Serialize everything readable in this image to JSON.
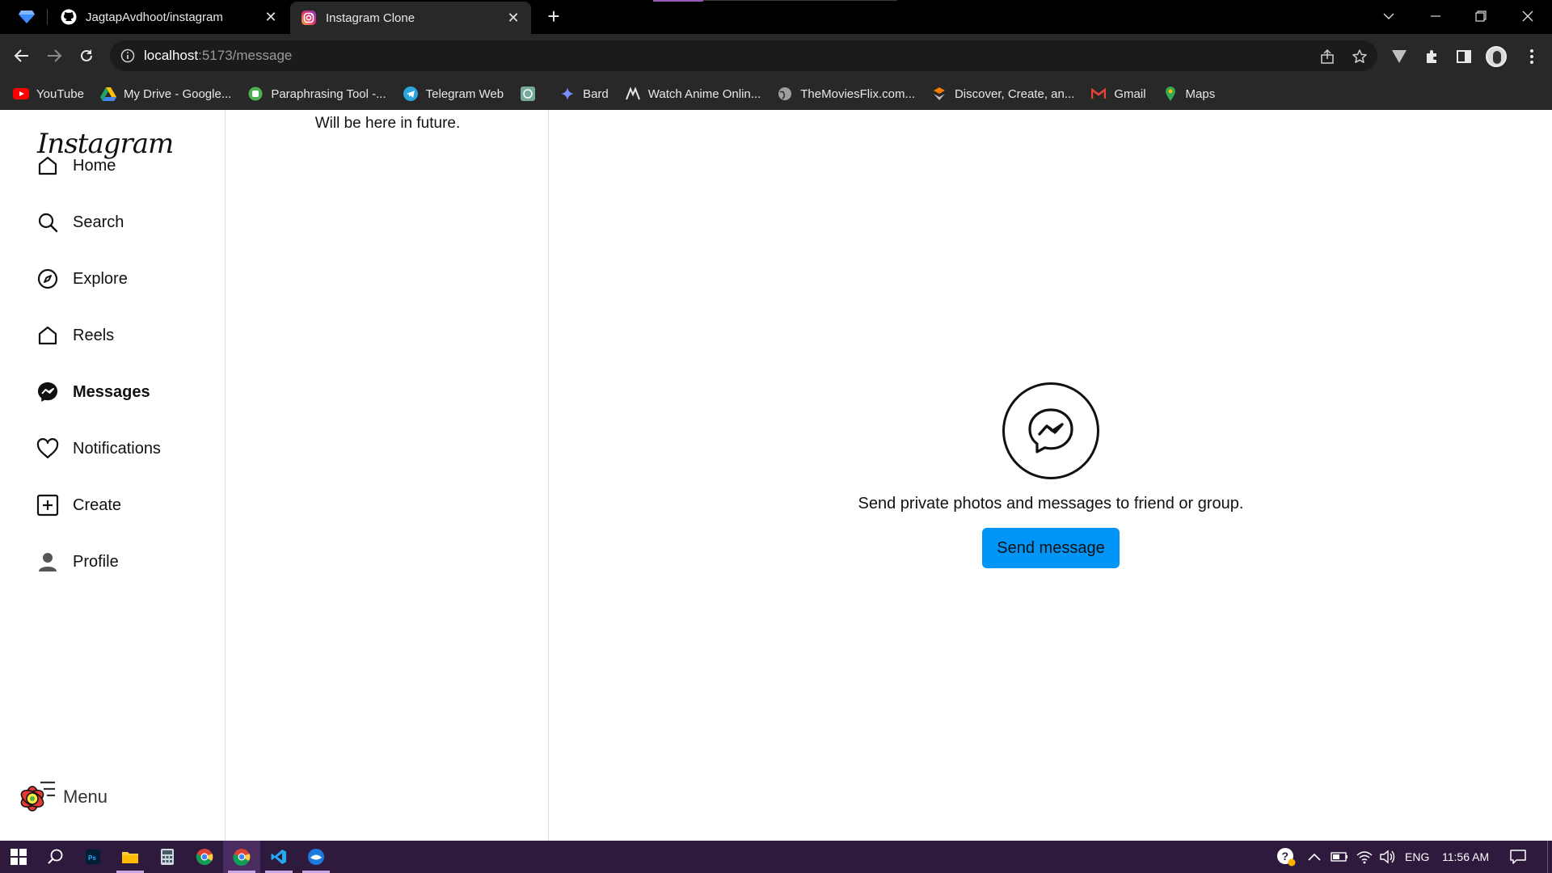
{
  "browser": {
    "tabs": [
      {
        "title": "JagtapAvdhoot/instagram",
        "icon": "github-icon"
      },
      {
        "title": "Instagram Clone",
        "icon": "instagram-icon"
      }
    ],
    "close_glyph": "✕",
    "new_tab_glyph": "+",
    "url_host": "localhost",
    "url_path": ":5173/message",
    "bookmarks": [
      {
        "label": "YouTube",
        "icon": "youtube-icon"
      },
      {
        "label": "My Drive - Google...",
        "icon": "google-drive-icon"
      },
      {
        "label": "Paraphrasing Tool -...",
        "icon": "paraphrasing-icon"
      },
      {
        "label": "Telegram Web",
        "icon": "telegram-icon"
      },
      {
        "label": "",
        "icon": "chatgpt-icon"
      },
      {
        "label": "Bard",
        "icon": "bard-icon"
      },
      {
        "label": "Watch Anime Onlin...",
        "icon": "anime-icon"
      },
      {
        "label": "TheMoviesFlix.com...",
        "icon": "globe-icon"
      },
      {
        "label": "Discover, Create, an...",
        "icon": "discover-icon"
      },
      {
        "label": "Gmail",
        "icon": "gmail-icon"
      },
      {
        "label": "Maps",
        "icon": "maps-icon"
      }
    ]
  },
  "app": {
    "logo": "Instagram",
    "nav": [
      {
        "label": "Home",
        "icon": "home-icon"
      },
      {
        "label": "Search",
        "icon": "search-icon"
      },
      {
        "label": "Explore",
        "icon": "compass-icon"
      },
      {
        "label": "Reels",
        "icon": "reels-icon"
      },
      {
        "label": "Messages",
        "icon": "messenger-icon",
        "active": true
      },
      {
        "label": "Notifications",
        "icon": "heart-icon"
      },
      {
        "label": "Create",
        "icon": "plus-square-icon"
      },
      {
        "label": "Profile",
        "icon": "user-icon"
      }
    ],
    "menu_label": "Menu",
    "conversation_placeholder": "Will be here in future.",
    "empty_state_text": "Send private photos and messages to friend or group.",
    "send_button": "Send message",
    "accent_color": "#0095f6"
  },
  "taskbar": {
    "language": "ENG",
    "time": "11:56 AM"
  }
}
